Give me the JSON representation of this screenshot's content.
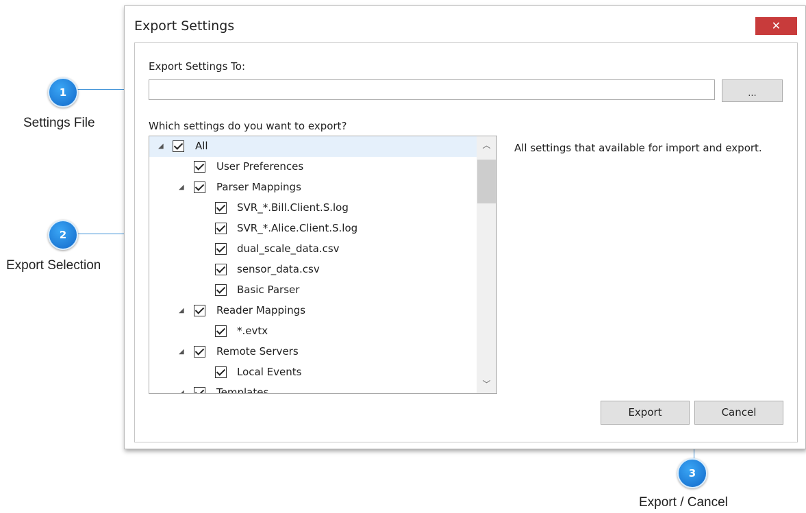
{
  "dialog": {
    "title": "Export Settings",
    "close_label": "✕",
    "export_to_label": "Export Settings To:",
    "path_value": "",
    "browse_label": "...",
    "which_label": "Which settings do you want to export?",
    "description": "All settings that available for import and export.",
    "export_button": "Export",
    "cancel_button": "Cancel",
    "tree": [
      {
        "label": "All",
        "checked": true
      },
      {
        "label": "User Preferences",
        "checked": true
      },
      {
        "label": "Parser Mappings",
        "checked": true
      },
      {
        "label": "SVR_*.Bill.Client.S.log",
        "checked": true
      },
      {
        "label": "SVR_*.Alice.Client.S.log",
        "checked": true
      },
      {
        "label": "dual_scale_data.csv",
        "checked": true
      },
      {
        "label": "sensor_data.csv",
        "checked": true
      },
      {
        "label": "Basic Parser",
        "checked": true
      },
      {
        "label": "Reader Mappings",
        "checked": true
      },
      {
        "label": "*.evtx",
        "checked": true
      },
      {
        "label": "Remote Servers",
        "checked": true
      },
      {
        "label": "Local Events",
        "checked": true
      },
      {
        "label": "Templates",
        "checked": true
      }
    ]
  },
  "callouts": [
    {
      "number": "1",
      "label": "Settings File"
    },
    {
      "number": "2",
      "label": "Export Selection"
    },
    {
      "number": "3",
      "label": "Export / Cancel"
    }
  ]
}
